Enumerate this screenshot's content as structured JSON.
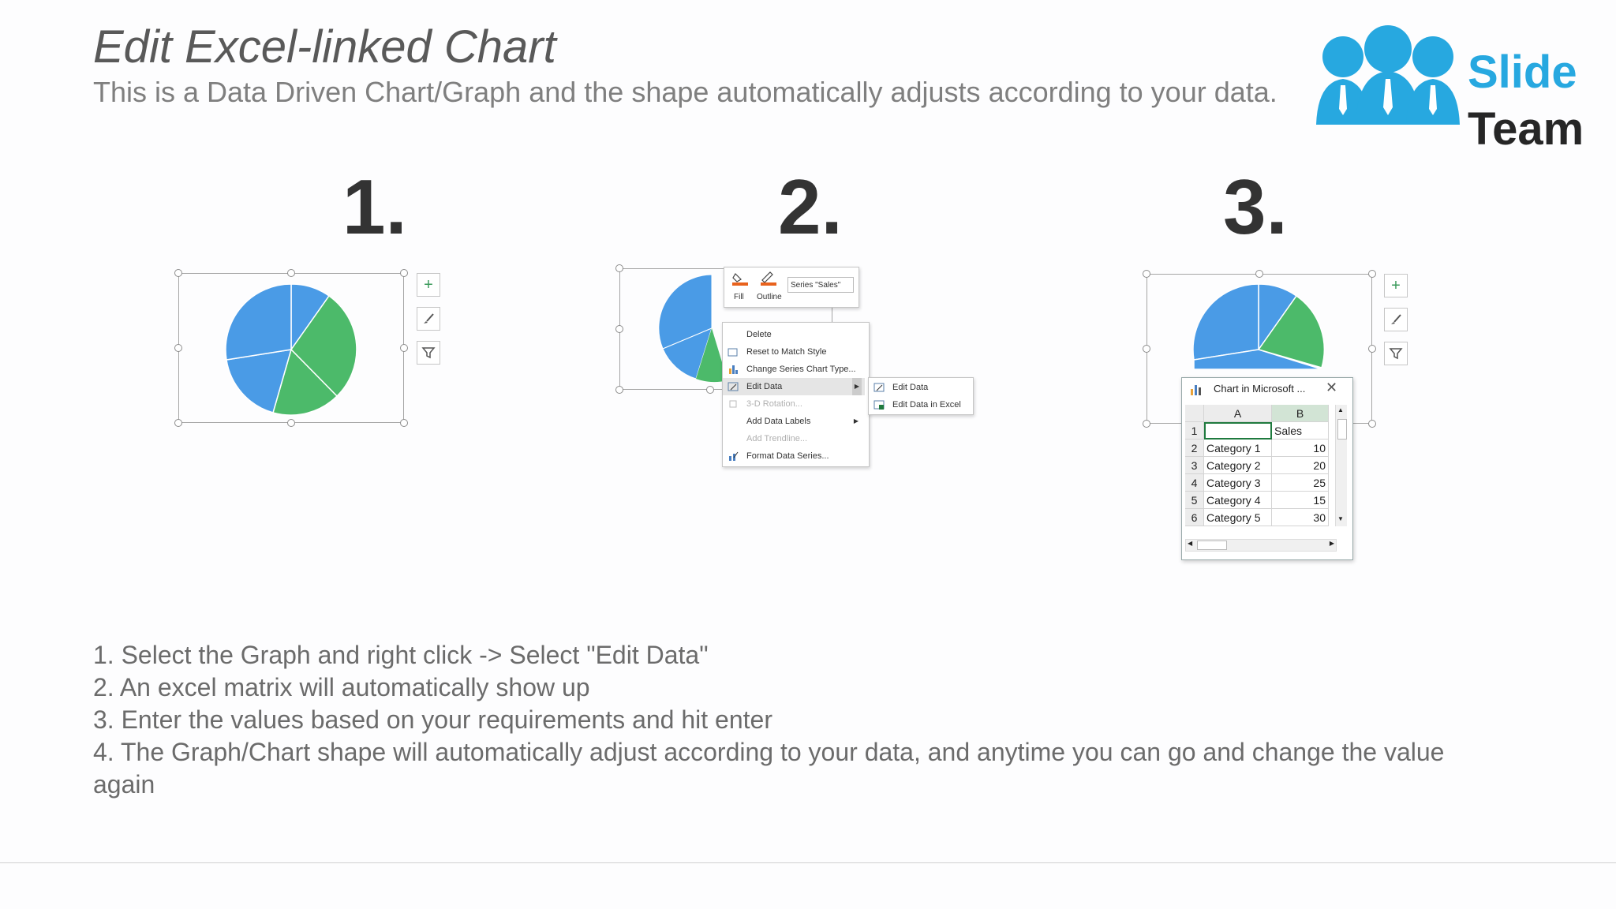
{
  "title": "Edit Excel-linked Chart",
  "subtitle": "This is a Data Driven Chart/Graph and the shape automatically adjusts according to your data.",
  "logo": {
    "word1": "Slide",
    "word2": "Team"
  },
  "steps": [
    "1.",
    "2.",
    "3."
  ],
  "menu": {
    "fill_label": "Fill",
    "outline_label": "Outline",
    "series_select": "Series \"Sales\"",
    "items": [
      "Delete",
      "Reset to Match Style",
      "Change Series Chart Type...",
      "Edit Data",
      "3-D Rotation...",
      "Add Data Labels",
      "Add Trendline...",
      "Format Data Series..."
    ],
    "submenu": [
      "Edit Data",
      "Edit Data in Excel"
    ]
  },
  "sheet": {
    "title": "Chart in Microsoft ...",
    "col_a": "A",
    "col_b": "B",
    "row_numbers": [
      "1",
      "2",
      "3",
      "4",
      "5",
      "6"
    ],
    "header_b": "Sales",
    "rows": [
      {
        "category": "Category 1",
        "value": "10"
      },
      {
        "category": "Category 2",
        "value": "20"
      },
      {
        "category": "Category 3",
        "value": "25"
      },
      {
        "category": "Category 4",
        "value": "15"
      },
      {
        "category": "Category 5",
        "value": "30"
      }
    ]
  },
  "instructions": [
    "1. Select the Graph and right click -> Select \"Edit Data\"",
    "2. An excel matrix will automatically show up",
    "3. Enter the values based on your requirements and hit enter",
    "4. The Graph/Chart shape will automatically adjust according to your data, and anytime you can go and change the value",
    "again"
  ],
  "colors": {
    "pie_blue": "#4a9be6",
    "pie_green": "#4cba6a",
    "logo_blue": "#27a8e0"
  }
}
